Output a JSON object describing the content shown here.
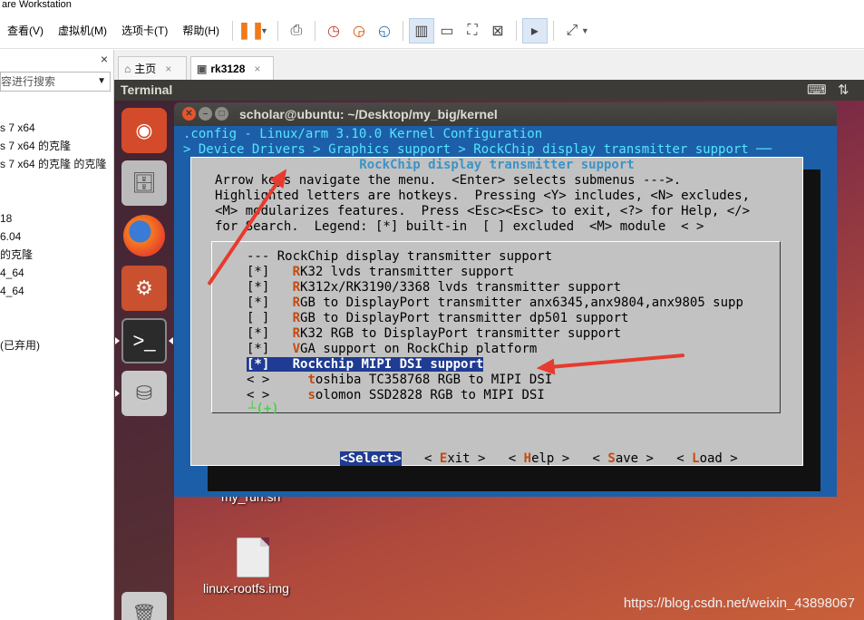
{
  "app": {
    "title": "are Workstation"
  },
  "menubar": {
    "items": [
      "查看(V)",
      "虚拟机(M)",
      "选项卡(T)",
      "帮助(H)"
    ]
  },
  "toolbar": {
    "icons": [
      "pause-icon",
      "send-keys-icon",
      "snapshot-icon",
      "revert-snapshot-icon",
      "snapshot-manager-icon",
      "view-library-icon",
      "view-thumbnail-icon",
      "fullscreen-icon",
      "unity-icon",
      "console-icon",
      "stretch-icon"
    ]
  },
  "library": {
    "close": "×",
    "search_placeholder": "容进行搜索",
    "items": [
      "s 7 x64",
      "s 7 x64 的克隆",
      "s 7 x64 的克隆 的克隆",
      "",
      "",
      "18",
      "6.04",
      "的克隆",
      "4_64",
      "4_64",
      "",
      "",
      "(已弃用)"
    ]
  },
  "tabs": [
    {
      "label": "主页",
      "close": "×",
      "icon": "home-icon"
    },
    {
      "label": "rk3128",
      "close": "×",
      "icon": "vm-icon"
    }
  ],
  "ubuntu": {
    "panel_title": "Terminal"
  },
  "terminal": {
    "title": "scholar@ubuntu: ~/Desktop/my_big/kernel",
    "header_line1": ".config - Linux/arm 3.10.0 Kernel Configuration",
    "header_line2": "> Device Drivers > Graphics support > RockChip display transmitter support ──",
    "dialog": {
      "title": "RockChip display transmitter support",
      "help": [
        "Arrow keys navigate the menu.  <Enter> selects submenus --->.",
        "Highlighted letters are hotkeys.  Pressing <Y> includes, <N> excludes,",
        "<M> modularizes features.  Press <Esc><Esc> to exit, <?> for Help, </>",
        "for Search.  Legend: [*] built-in  [ ] excluded  <M> module  < >"
      ],
      "header_item": "--- RockChip display transmitter support",
      "items": [
        {
          "mark": "[*]",
          "hot": "R",
          "rest": "K32 lvds transmitter support",
          "indent": ""
        },
        {
          "mark": "[*]",
          "hot": "R",
          "rest": "K312x/RK3190/3368 lvds transmitter support",
          "indent": ""
        },
        {
          "mark": "[*]",
          "hot": "R",
          "rest": "GB to DisplayPort transmitter anx6345,anx9804,anx9805 supp",
          "indent": ""
        },
        {
          "mark": "[ ]",
          "hot": "R",
          "rest": "GB to DisplayPort transmitter dp501 support",
          "indent": ""
        },
        {
          "mark": "[*]",
          "hot": "R",
          "rest": "K32 RGB to DisplayPort transmitter support",
          "indent": ""
        },
        {
          "mark": "[*]",
          "hot": "V",
          "rest": "GA support on RockChip platform",
          "indent": ""
        },
        {
          "mark": "[*]",
          "hot": "R",
          "rest": "ockchip MIPI DSI support",
          "indent": "",
          "selected": true
        },
        {
          "mark": "< >",
          "hot": "t",
          "rest": "oshiba TC358768 RGB to MIPI DSI",
          "indent": "  "
        },
        {
          "mark": "< >",
          "hot": "s",
          "rest": "olomon SSD2828 RGB to MIPI DSI",
          "indent": "  "
        }
      ],
      "more": "┴(+)",
      "buttons": {
        "select": "<Select>",
        "exit_pre": "< ",
        "exit_hot": "E",
        "exit_rest": "xit >",
        "help_pre": "< ",
        "help_hot": "H",
        "help_rest": "elp >",
        "save_pre": "< ",
        "save_hot": "S",
        "save_rest": "ave >",
        "load_pre": "< ",
        "load_hot": "L",
        "load_rest": "oad >"
      }
    }
  },
  "desktop": {
    "files": [
      {
        "label": "my_run.sh"
      },
      {
        "label": "linux-rootfs.img"
      }
    ],
    "watermark": "https://blog.csdn.net/weixin_43898067"
  },
  "annotation_color": "#e63b2e"
}
